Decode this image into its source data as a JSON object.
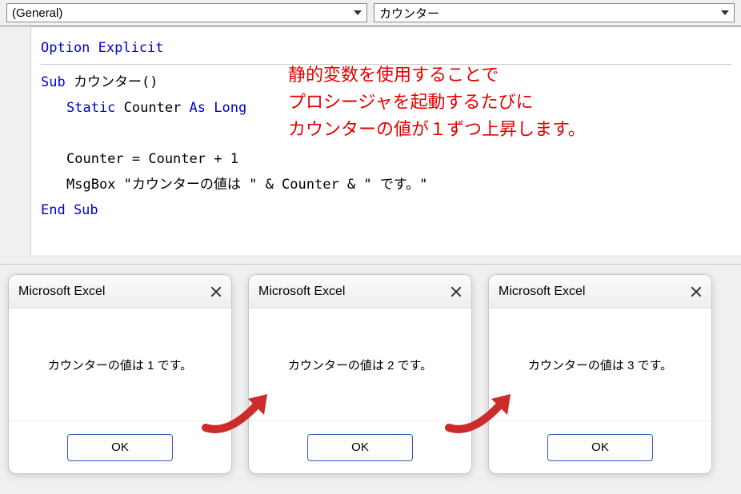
{
  "dropdowns": {
    "left": "(General)",
    "right": "カウンター"
  },
  "annotation": {
    "line1": "静的変数を使用することで",
    "line2": "プロシージャを起動するたびに",
    "line3": "カウンターの値が１ずつ上昇します。"
  },
  "code": {
    "l1_kw": "Option Explicit",
    "l2a_kw": "Sub",
    "l2b": " カウンター()",
    "l3a_kw": "Static",
    "l3b": " Counter ",
    "l3c_kw": "As Long",
    "l4": "Counter = Counter + 1",
    "l5": "MsgBox \"カウンターの値は \" & Counter & \" です。\"",
    "l6_kw": "End Sub"
  },
  "dialog": {
    "title": "Microsoft Excel",
    "ok": "OK",
    "msg1": "カウンターの値は 1 です。",
    "msg2": "カウンターの値は 2 です。",
    "msg3": "カウンターの値は 3 です。"
  }
}
